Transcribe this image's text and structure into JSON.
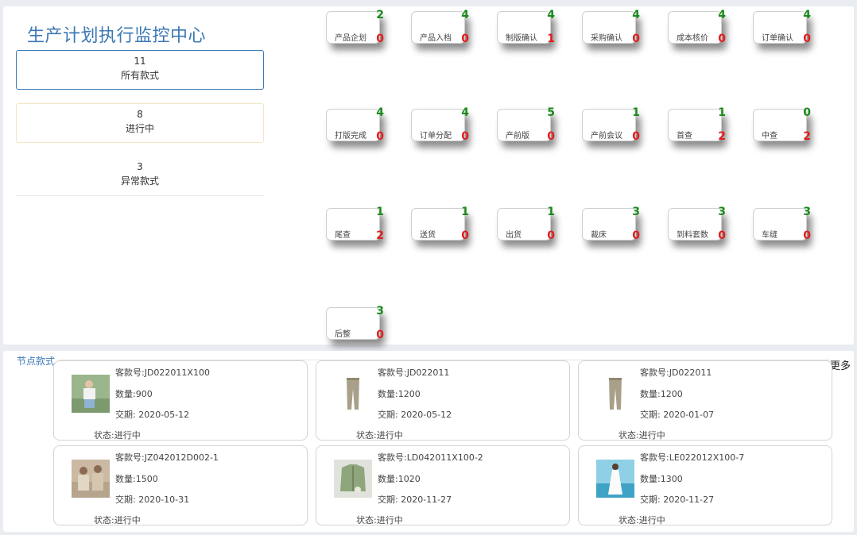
{
  "header": {
    "title": "生产计划执行监控中心"
  },
  "summary": [
    {
      "count": "11",
      "label": "所有款式"
    },
    {
      "count": "8",
      "label": "进行中"
    },
    {
      "count": "3",
      "label": "异常款式"
    }
  ],
  "nodes": [
    {
      "label": "产品企划",
      "done": "2",
      "abnormal": "0"
    },
    {
      "label": "产品入档",
      "done": "4",
      "abnormal": "0"
    },
    {
      "label": "制版确认",
      "done": "4",
      "abnormal": "1"
    },
    {
      "label": "采购确认",
      "done": "4",
      "abnormal": "0"
    },
    {
      "label": "成本核价",
      "done": "4",
      "abnormal": "0"
    },
    {
      "label": "订单确认",
      "done": "4",
      "abnormal": "0"
    },
    {
      "label": "打版完成",
      "done": "4",
      "abnormal": "0"
    },
    {
      "label": "订单分配",
      "done": "4",
      "abnormal": "0"
    },
    {
      "label": "产前版",
      "done": "5",
      "abnormal": "0"
    },
    {
      "label": "产前会议",
      "done": "1",
      "abnormal": "0"
    },
    {
      "label": "首查",
      "done": "1",
      "abnormal": "2"
    },
    {
      "label": "中查",
      "done": "0",
      "abnormal": "2"
    },
    {
      "label": "尾查",
      "done": "1",
      "abnormal": "2"
    },
    {
      "label": "送货",
      "done": "1",
      "abnormal": "0"
    },
    {
      "label": "出货",
      "done": "1",
      "abnormal": "0"
    },
    {
      "label": "裁床",
      "done": "3",
      "abnormal": "0"
    },
    {
      "label": "到料套数",
      "done": "3",
      "abnormal": "0"
    },
    {
      "label": "车缝",
      "done": "3",
      "abnormal": "0"
    },
    {
      "label": "后整",
      "done": "3",
      "abnormal": "0"
    }
  ],
  "section": {
    "label": "节点款式",
    "more": "更多"
  },
  "styles": [
    {
      "style_no": "客款号:JD022011X100",
      "qty": "数量:900",
      "due": "交期: 2020-05-12",
      "status": "状态:进行中",
      "thumb": "tshirt-photo"
    },
    {
      "style_no": "客款号:JD022011",
      "qty": "数量:1200",
      "due": "交期: 2020-05-12",
      "status": "状态:进行中",
      "thumb": "khaki-pants"
    },
    {
      "style_no": "客款号:JD022011",
      "qty": "数量:1200",
      "due": "交期: 2020-01-07",
      "status": "状态:进行中",
      "thumb": "khaki-pants"
    },
    {
      "style_no": "客款号:JZ042012D002-1",
      "qty": "数量:1500",
      "due": "交期: 2020-10-31",
      "status": "状态:进行中",
      "thumb": "beige-knit-photo"
    },
    {
      "style_no": "客款号:LD042011X100-2",
      "qty": "数量:1020",
      "due": "交期: 2020-11-27",
      "status": "状态:进行中",
      "thumb": "green-jacket-photo"
    },
    {
      "style_no": "客款号:LE022012X100-7",
      "qty": "数量:1300",
      "due": "交期: 2020-11-27",
      "status": "状态:进行中",
      "thumb": "white-dress-photo"
    }
  ],
  "colors": {
    "accent": "#3c78b4",
    "done": "#1a8a1a",
    "abnormal": "#e31b1b"
  }
}
